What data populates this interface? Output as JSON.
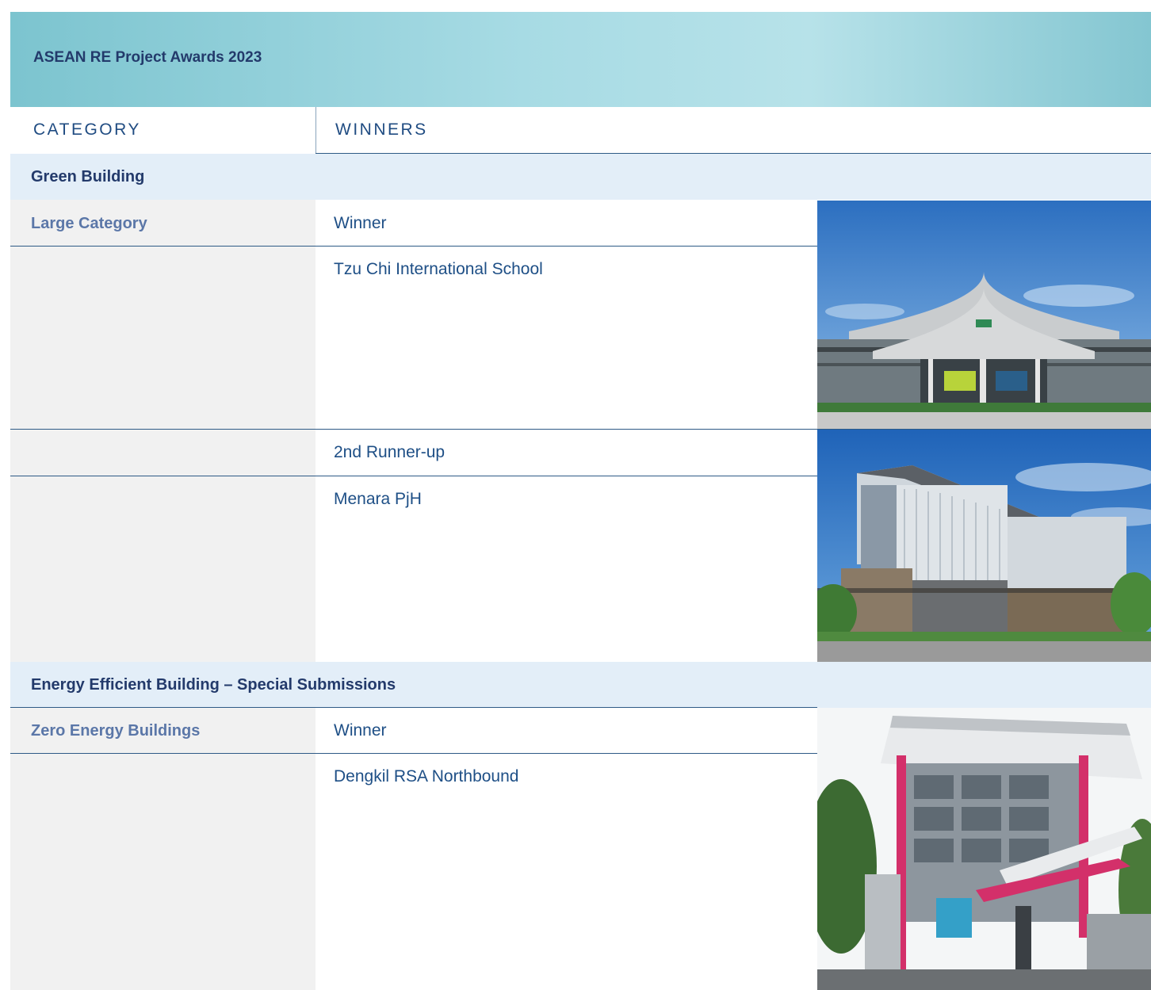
{
  "banner": {
    "title": "ASEAN RE Project Awards 2023"
  },
  "columns": {
    "category": "CATEGORY",
    "winners": "WINNERS"
  },
  "sections": [
    {
      "title": "Green Building",
      "rows": [
        {
          "category": "Large Category",
          "award": "Winner",
          "project": "Tzu Chi International School",
          "photo": "school-building-photo"
        },
        {
          "category": "",
          "award": "2nd Runner-up",
          "project": "Menara PjH",
          "photo": "office-tower-photo"
        }
      ]
    },
    {
      "title": "Energy Efficient Building – Special Submissions",
      "rows": [
        {
          "category": "Zero Energy Buildings",
          "award": "Winner",
          "project": "Dengkil RSA Northbound",
          "photo": "rest-area-building-photo"
        }
      ]
    }
  ],
  "colors": {
    "heading": "#233a6b",
    "category_text": "#5b77a8",
    "body_text": "#1e4f86",
    "section_bg": "#e3eef8",
    "category_bg": "#f1f1f1"
  }
}
